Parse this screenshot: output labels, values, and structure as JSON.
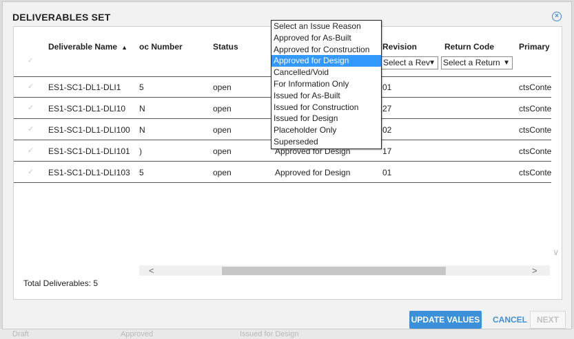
{
  "modal": {
    "title": "DELIVERABLES SET",
    "close_icon": "×"
  },
  "columns": {
    "deliverable_name": "Deliverable Name",
    "sort_indicator": "▲",
    "doc_number": "oc Number",
    "status": "Status",
    "revision": "Revision",
    "return_code": "Return Code",
    "primary_doc": "Primary Do"
  },
  "filters": {
    "revision": "Select a Rev",
    "return_code": "Select a Return"
  },
  "rows": [
    {
      "name": "ES1-SC1-DL1-DLI1",
      "doc": "5",
      "status": "open",
      "reason": "",
      "revision": "01",
      "primary": "ctsConte"
    },
    {
      "name": "ES1-SC1-DL1-DLI10",
      "doc": "N",
      "status": "open",
      "reason": "",
      "revision": "27",
      "primary": "ctsConte"
    },
    {
      "name": "ES1-SC1-DL1-DLI100",
      "doc": "N",
      "status": "open",
      "reason": "",
      "revision": "02",
      "primary": "ctsConte"
    },
    {
      "name": "ES1-SC1-DL1-DLI101",
      "doc": ")",
      "status": "open",
      "reason": "Approved for Design",
      "revision": "17",
      "primary": "ctsConte"
    },
    {
      "name": "ES1-SC1-DL1-DLI103",
      "doc": "5",
      "status": "open",
      "reason": "Approved for Design",
      "revision": "01",
      "primary": "ctsConte"
    }
  ],
  "dropdown": {
    "options": [
      "Select an Issue Reason",
      "Approved for As-Built",
      "Approved for Construction",
      "Approved for Design",
      "Cancelled/Void",
      "For Information Only",
      "Issued for As-Built",
      "Issued for Construction",
      "Issued for Design",
      "Placeholder Only",
      "Superseded"
    ],
    "selected_index": 3
  },
  "footer": {
    "total": "Total Deliverables: 5",
    "update_label": "UPDATE VALUES",
    "cancel_label": "CANCEL",
    "next_label": "NEXT"
  },
  "icons": {
    "check": "✓",
    "caret": "▼",
    "scroll_left": "<",
    "scroll_right": ">",
    "scroll_down": "∨"
  },
  "colors": {
    "accent": "#3c8fd9",
    "selected_option": "#3399ff"
  },
  "background": {
    "texts": [
      "Draft",
      "Approved",
      "Issued for Design"
    ]
  }
}
